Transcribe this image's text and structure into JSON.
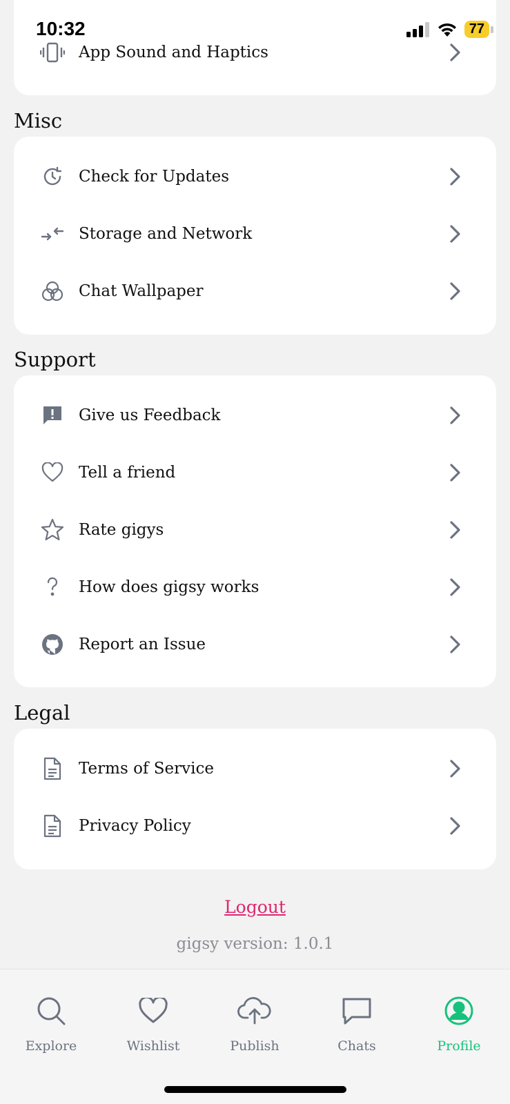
{
  "status": {
    "time": "10:32",
    "battery": "77"
  },
  "top_card": {
    "items": [
      {
        "label": "App Sound and Haptics",
        "icon": "vibrate-icon"
      }
    ]
  },
  "sections": [
    {
      "title": "Misc",
      "items": [
        {
          "label": "Check for Updates",
          "icon": "update-clock-icon"
        },
        {
          "label": "Storage and Network",
          "icon": "arrows-swap-icon"
        },
        {
          "label": "Chat Wallpaper",
          "icon": "circles-overlap-icon"
        }
      ]
    },
    {
      "title": "Support",
      "items": [
        {
          "label": "Give us Feedback",
          "icon": "feedback-icon"
        },
        {
          "label": "Tell a friend",
          "icon": "heart-icon"
        },
        {
          "label": "Rate gigys",
          "icon": "star-icon"
        },
        {
          "label": "How does gigsy works",
          "icon": "question-icon"
        },
        {
          "label": "Report an Issue",
          "icon": "github-icon"
        }
      ]
    },
    {
      "title": "Legal",
      "items": [
        {
          "label": "Terms of Service",
          "icon": "document-icon"
        },
        {
          "label": "Privacy Policy",
          "icon": "document-icon"
        }
      ]
    }
  ],
  "logout_label": "Logout",
  "version_text": "gigsy version: 1.0.1",
  "tabs": [
    {
      "label": "Explore",
      "icon": "search-icon"
    },
    {
      "label": "Wishlist",
      "icon": "heart-icon"
    },
    {
      "label": "Publish",
      "icon": "cloud-upload-icon"
    },
    {
      "label": "Chats",
      "icon": "chat-bubble-icon"
    },
    {
      "label": "Profile",
      "icon": "profile-icon",
      "active": true
    }
  ],
  "colors": {
    "accent": "#15c27c",
    "logout": "#e0266f",
    "icon": "#6b7280"
  }
}
